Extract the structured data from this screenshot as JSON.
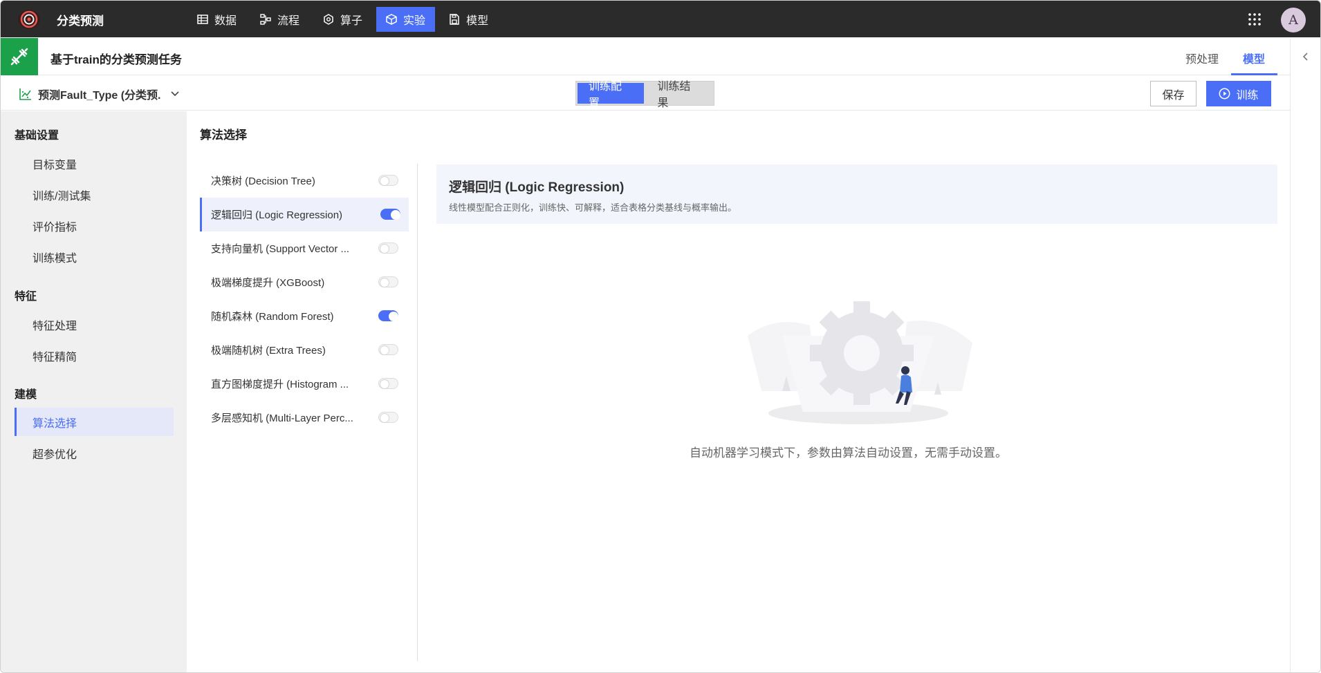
{
  "app": {
    "title": "分类预测",
    "avatar_letter": "A"
  },
  "nav": [
    {
      "label": "数据",
      "icon": "table-grid-icon",
      "active": false
    },
    {
      "label": "流程",
      "icon": "workflow-icon",
      "active": false
    },
    {
      "label": "算子",
      "icon": "hexagon-operator-icon",
      "active": false
    },
    {
      "label": "实验",
      "icon": "cube-experiment-icon",
      "active": true
    },
    {
      "label": "模型",
      "icon": "save-model-icon",
      "active": false
    }
  ],
  "task": {
    "title": "基于train的分类预测任务",
    "tabs": [
      "预处理",
      "模型"
    ],
    "active_tab": "模型"
  },
  "toolbar": {
    "target_label": "预测Fault_Type (分类预...",
    "segments": [
      "训练配置",
      "训练结果"
    ],
    "active_segment": "训练配置",
    "save_label": "保存",
    "train_label": "训练"
  },
  "sidebar": {
    "groups": [
      {
        "title": "基础设置",
        "items": [
          "目标变量",
          "训练/测试集",
          "评价指标",
          "训练模式"
        ]
      },
      {
        "title": "特征",
        "items": [
          "特征处理",
          "特征精简"
        ]
      },
      {
        "title": "建模",
        "items": [
          "算法选择",
          "超参优化"
        ]
      }
    ],
    "active_item": "算法选择"
  },
  "main": {
    "section_title": "算法选择",
    "algorithms": [
      {
        "label": "决策树 (Decision Tree)",
        "enabled": false,
        "selected": false
      },
      {
        "label": "逻辑回归 (Logic Regression)",
        "enabled": true,
        "selected": true
      },
      {
        "label": "支持向量机 (Support Vector ...",
        "enabled": false,
        "selected": false
      },
      {
        "label": "极端梯度提升 (XGBoost)",
        "enabled": false,
        "selected": false
      },
      {
        "label": "随机森林 (Random Forest)",
        "enabled": true,
        "selected": false
      },
      {
        "label": "极端随机树 (Extra Trees)",
        "enabled": false,
        "selected": false
      },
      {
        "label": "直方图梯度提升 (Histogram ...",
        "enabled": false,
        "selected": false
      },
      {
        "label": "多层感知机 (Multi-Layer Perc...",
        "enabled": false,
        "selected": false
      }
    ],
    "detail": {
      "title": "逻辑回归 (Logic Regression)",
      "description": "线性模型配合正则化，训练快、可解释，适合表格分类基线与概率输出。"
    },
    "empty_message": "自动机器学习模式下，参数由算法自动设置，无需手动设置。"
  },
  "colors": {
    "accent": "#4a6ef5",
    "topbar": "#2b2b2b",
    "task_icon": "#1aa14a"
  }
}
